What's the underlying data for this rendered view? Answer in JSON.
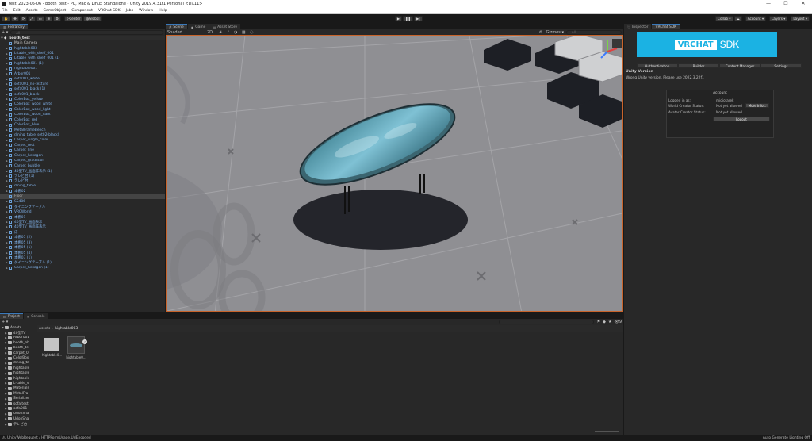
{
  "window": {
    "title": "test_2023-05-06 - booth_test - PC, Mac & Linux Standalone - Unity 2019.4.31f1 Personal <DX11>",
    "minimize": "—",
    "maximize": "☐",
    "close": "✕"
  },
  "menu": [
    "File",
    "Edit",
    "Assets",
    "GameObject",
    "Component",
    "VRChat SDK",
    "Jobs",
    "Window",
    "Help"
  ],
  "toolbar": {
    "center_label": "Center",
    "global_label": "Global",
    "play": "▶",
    "pause": "❚❚",
    "step": "▶|",
    "collab_label": "Collab ▾",
    "account_label": "Account ▾",
    "layers_label": "Layers ▾",
    "layout_label": "Layout ▾"
  },
  "hierarchy": {
    "tab_label": "Hierarchy",
    "add_label": "+ ▾",
    "search_placeholder": "All",
    "scene_name": "booth_test",
    "items": [
      {
        "name": "Main Camera",
        "color": "white",
        "indent": 1,
        "arrow": ""
      },
      {
        "name": "hightable003",
        "color": "blue",
        "indent": 1,
        "arrow": "▶"
      },
      {
        "name": "L-table_with_shelf_001",
        "color": "blue",
        "indent": 1,
        "arrow": "▶"
      },
      {
        "name": "L-table_with_shelf_001 (1)",
        "color": "blue",
        "indent": 1,
        "arrow": "▶"
      },
      {
        "name": "hightable001 (1)",
        "color": "blue",
        "indent": 1,
        "arrow": "▶"
      },
      {
        "name": "hightable001",
        "color": "blue",
        "indent": 1,
        "arrow": "▶"
      },
      {
        "name": "Arbor001",
        "color": "blue",
        "indent": 1,
        "arrow": "▶"
      },
      {
        "name": "sofa001_white",
        "color": "blue",
        "indent": 1,
        "arrow": "▶"
      },
      {
        "name": "sofa001_no-texture",
        "color": "blue",
        "indent": 1,
        "arrow": "▶"
      },
      {
        "name": "sofa001_black (1)",
        "color": "blue",
        "indent": 1,
        "arrow": "▶"
      },
      {
        "name": "sofa001_black",
        "color": "blue",
        "indent": 1,
        "arrow": "▶"
      },
      {
        "name": "ColorBox_yellow",
        "color": "blue",
        "indent": 1,
        "arrow": "▶"
      },
      {
        "name": "ColorBox_wood_white",
        "color": "blue",
        "indent": 1,
        "arrow": "▶"
      },
      {
        "name": "ColorBox_wood_light",
        "color": "blue",
        "indent": 1,
        "arrow": "▶"
      },
      {
        "name": "ColorBox_wood_dark",
        "color": "blue",
        "indent": 1,
        "arrow": "▶"
      },
      {
        "name": "ColorBox_red",
        "color": "blue",
        "indent": 1,
        "arrow": "▶"
      },
      {
        "name": "ColorBox_blue",
        "color": "blue",
        "indent": 1,
        "arrow": "▶"
      },
      {
        "name": "MetalFrameBench",
        "color": "blue",
        "indent": 1,
        "arrow": "▶"
      },
      {
        "name": "dining_table_set02(black)",
        "color": "blue",
        "indent": 1,
        "arrow": "▶"
      },
      {
        "name": "Carpet_single_color",
        "color": "blue",
        "indent": 1,
        "arrow": "▶"
      },
      {
        "name": "Carpet_rect",
        "color": "blue",
        "indent": 1,
        "arrow": "▶"
      },
      {
        "name": "Carpet_line",
        "color": "blue",
        "indent": 1,
        "arrow": "▶"
      },
      {
        "name": "Carpet_hexagon",
        "color": "blue",
        "indent": 1,
        "arrow": "▶"
      },
      {
        "name": "Carpet_gradation",
        "color": "blue",
        "indent": 1,
        "arrow": "▶"
      },
      {
        "name": "Carpet_bubble",
        "color": "blue",
        "indent": 1,
        "arrow": "▶"
      },
      {
        "name": "40型TV_画面非表示 (1)",
        "color": "blue",
        "indent": 1,
        "arrow": "▶"
      },
      {
        "name": "テレビ台 (1)",
        "color": "blue",
        "indent": 1,
        "arrow": "▶"
      },
      {
        "name": "テレビ台",
        "color": "blue",
        "indent": 1,
        "arrow": "▶"
      },
      {
        "name": "dining_table",
        "color": "blue",
        "indent": 1,
        "arrow": "▶"
      },
      {
        "name": "本棚02",
        "color": "blue",
        "indent": 1,
        "arrow": "▶"
      },
      {
        "name": "Floor",
        "color": "grey",
        "indent": 1,
        "arrow": "",
        "selected": true
      },
      {
        "name": "SS486",
        "color": "blue",
        "indent": 1,
        "arrow": "▶"
      },
      {
        "name": "ダイニングテーブル",
        "color": "blue",
        "indent": 1,
        "arrow": "▶"
      },
      {
        "name": "VRCWorld",
        "color": "blue",
        "indent": 1,
        "arrow": "▶"
      },
      {
        "name": "本棚01",
        "color": "blue",
        "indent": 1,
        "arrow": "▶"
      },
      {
        "name": "40型TV_画面表示",
        "color": "blue",
        "indent": 1,
        "arrow": "▶"
      },
      {
        "name": "40型TV_画面非表示",
        "color": "blue",
        "indent": 1,
        "arrow": "▶"
      },
      {
        "name": "床",
        "color": "blue",
        "indent": 1,
        "arrow": "▶"
      },
      {
        "name": "本棚05 (2)",
        "color": "blue",
        "indent": 1,
        "arrow": "▶"
      },
      {
        "name": "本棚05 (3)",
        "color": "blue",
        "indent": 1,
        "arrow": "▶"
      },
      {
        "name": "本棚05 (1)",
        "color": "blue",
        "indent": 1,
        "arrow": "▶"
      },
      {
        "name": "本棚05 (4)",
        "color": "blue",
        "indent": 1,
        "arrow": "▶"
      },
      {
        "name": "本棚03 (1)",
        "color": "blue",
        "indent": 1,
        "arrow": "▶"
      },
      {
        "name": "ダイニングテーブル (1)",
        "color": "blue",
        "indent": 1,
        "arrow": "▶"
      },
      {
        "name": "Carpet_hexagon (1)",
        "color": "blue",
        "indent": 1,
        "arrow": "▶"
      }
    ]
  },
  "scene": {
    "tabs": [
      "Scene",
      "Game",
      "Asset Store"
    ],
    "shading_mode": "Shaded",
    "mode_2d": "2D",
    "gizmos_label": "Gizmos ▾",
    "search_placeholder": "All"
  },
  "inspector": {
    "tabs": [
      "Inspector",
      "VRChat SDK"
    ],
    "banner_logo": "VRCHAT",
    "banner_sdk": "SDK",
    "sdk_tabs": [
      "Authentication",
      "Builder",
      "Content Manager",
      "Settings"
    ],
    "unity_version_title": "Unity Version",
    "unity_version_msg": "Wrong Unity version. Please use 2022.3.22f1",
    "account": {
      "title": "Account",
      "logged_in_label": "Logged in as:",
      "logged_in_value": "migiotarek",
      "world_label": "World Creator Status:",
      "world_value": "Not yet allowed",
      "more_info": "More Info...",
      "avatar_label": "Avatar Creator Status:",
      "avatar_value": "Not yet allowed",
      "logout": "Logout"
    }
  },
  "project": {
    "tabs": [
      "Project",
      "Console"
    ],
    "add_label": "+ ▾",
    "breadcrumb_root": "Assets",
    "breadcrumb_sep": "›",
    "breadcrumb_current": "hightable003",
    "tree_root": "Assets",
    "tree": [
      "40型TV",
      "Arbor001",
      "booth_ob",
      "booth_te",
      "carpet_0",
      "ColorBox",
      "dining_ta",
      "hightable",
      "hightable",
      "hightable",
      "L-table_v",
      "Materials",
      "MetalFra",
      "Serializer",
      "sofa test",
      "sofa001",
      "UdonSha",
      "UdonSha",
      "テレビ台"
    ],
    "files": [
      {
        "name": "hightable0...",
        "kind": "folder"
      },
      {
        "name": "hightable0...",
        "kind": "prefab"
      }
    ],
    "hidden_count": "9"
  },
  "status": {
    "message": "UnityWebRequest / HTTPFormUsage.UrlEncoded",
    "right": "Auto Generate Lighting Off"
  },
  "colors": {
    "accent": "#3a79bb",
    "vrchat_blue": "#1bb2e3",
    "scene_border": "#c8642b",
    "hierarchy_blue_text": "#7fb0e8"
  }
}
